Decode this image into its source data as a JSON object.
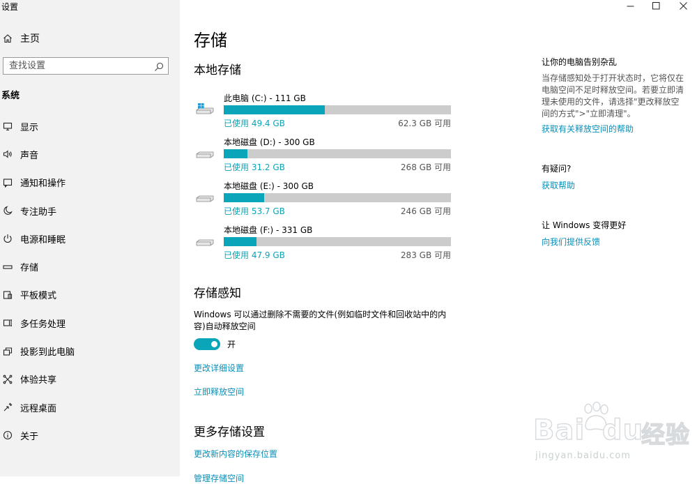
{
  "window": {
    "title": "设置",
    "controls": [
      "minimize",
      "maximize",
      "close"
    ]
  },
  "sidebar": {
    "home_label": "主页",
    "search_placeholder": "查找设置",
    "section_label": "系统",
    "items": [
      {
        "label": "显示",
        "icon": "monitor-icon"
      },
      {
        "label": "声音",
        "icon": "speaker-icon"
      },
      {
        "label": "通知和操作",
        "icon": "notification-icon"
      },
      {
        "label": "专注助手",
        "icon": "moon-icon"
      },
      {
        "label": "电源和睡眠",
        "icon": "power-icon"
      },
      {
        "label": "存储",
        "icon": "storage-icon",
        "selected": true
      },
      {
        "label": "平板模式",
        "icon": "tablet-icon"
      },
      {
        "label": "多任务处理",
        "icon": "multitask-icon"
      },
      {
        "label": "投影到此电脑",
        "icon": "projection-icon"
      },
      {
        "label": "体验共享",
        "icon": "share-icon"
      },
      {
        "label": "远程桌面",
        "icon": "remote-desktop-icon"
      },
      {
        "label": "关于",
        "icon": "info-icon"
      }
    ]
  },
  "main": {
    "title": "存储",
    "local_storage": {
      "heading": "本地存储",
      "drives": [
        {
          "name": "此电脑 (C:) - 111 GB",
          "used": "已使用 49.4 GB",
          "free": "62.3 GB 可用",
          "used_fraction": 0.445,
          "icon": "windows-drive-icon"
        },
        {
          "name": "本地磁盘 (D:) - 300 GB",
          "used": "已使用 31.2 GB",
          "free": "268 GB 可用",
          "used_fraction": 0.104,
          "icon": "drive-icon"
        },
        {
          "name": "本地磁盘 (E:) - 300 GB",
          "used": "已使用 53.7 GB",
          "free": "246 GB 可用",
          "used_fraction": 0.179,
          "icon": "drive-icon"
        },
        {
          "name": "本地磁盘 (F:) - 331 GB",
          "used": "已使用 47.9 GB",
          "free": "283 GB 可用",
          "used_fraction": 0.145,
          "icon": "drive-icon"
        }
      ]
    },
    "storage_sense": {
      "heading": "存储感知",
      "description": "Windows 可以通过删除不需要的文件(例如临时文件和回收站中的内容)自动释放空间",
      "toggle_label": "开",
      "toggle_on": true,
      "link_settings": "更改详细设置",
      "link_free_now": "立即释放空间"
    },
    "more_settings": {
      "heading": "更多存储设置",
      "link_save_location": "更改新内容的保存位置",
      "link_manage_spaces": "管理存储空间"
    }
  },
  "right_panel": {
    "tidy_heading": "让你的电脑告别杂乱",
    "tidy_text": "当存储感知处于打开状态时，它将仅在电脑空间不足时释放空间。若要立即清理未使用的文件，请选择\"更改释放空间的方式\">\"立即清理\"。",
    "tidy_link": "获取有关释放空间的帮助",
    "question_heading": "有疑问?",
    "question_link": "获取帮助",
    "improve_heading": "让 Windows 变得更好",
    "improve_link": "向我们提供反馈"
  },
  "watermark": {
    "brand": "Bai",
    "brand2": "du",
    "brand_cn": "经验",
    "url": "jingyan.baidu.com"
  },
  "colors": {
    "accent": "#0aa5b8",
    "link": "#0a8fb8",
    "sidebar_bg": "#f2f2f2",
    "bar_track": "#cccccc"
  }
}
